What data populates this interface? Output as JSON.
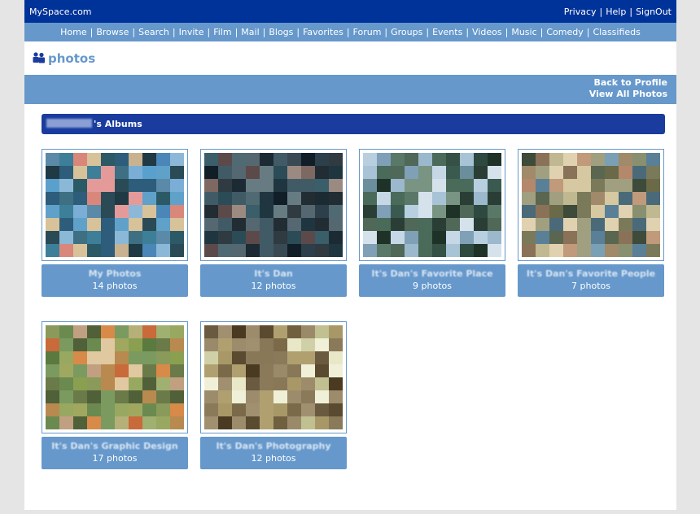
{
  "topbar": {
    "brand": "MySpace.com",
    "links": [
      "Privacy",
      "Help",
      "SignOut"
    ]
  },
  "nav": {
    "items": [
      "Home",
      "Browse",
      "Search",
      "Invite",
      "Film",
      "Mail",
      "Blogs",
      "Favorites",
      "Forum",
      "Groups",
      "Events",
      "Videos",
      "Music",
      "Comedy",
      "Classifieds"
    ]
  },
  "header": {
    "icon": "people-icon",
    "title": "photos"
  },
  "band": {
    "back_label": "Back to Profile",
    "view_all_label": "View All Photos"
  },
  "albums_bar": {
    "suffix": "'s Albums"
  },
  "albums": [
    {
      "title": "My Photos",
      "count": "14 photos"
    },
    {
      "title": "It's Dan",
      "count": "12 photos"
    },
    {
      "title": "It's Dan's Favorite Place",
      "count": "9 photos"
    },
    {
      "title": "It's Dan's Favorite People",
      "count": "7 photos"
    },
    {
      "title": "It's Dan's Graphic Design",
      "count": "17 photos"
    },
    {
      "title": "It's Dan's Photography",
      "count": "12 photos"
    }
  ],
  "colors": {
    "topbar": "#003399",
    "navbar": "#6698cb",
    "albums_bar": "#1a3c9e"
  }
}
